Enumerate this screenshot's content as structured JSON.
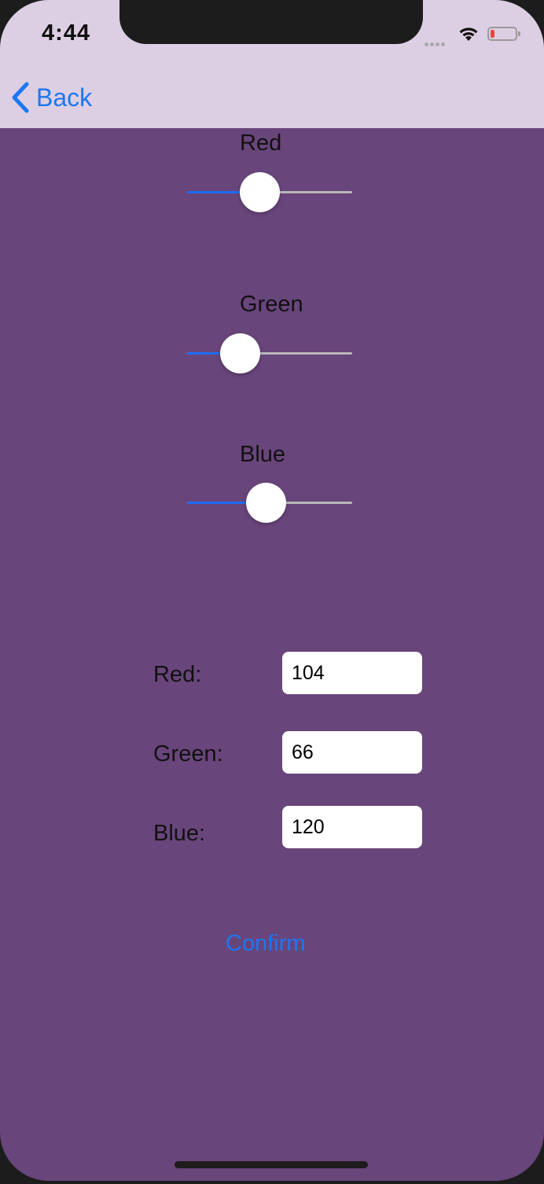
{
  "status_bar": {
    "time": "4:44"
  },
  "nav": {
    "back_label": "Back"
  },
  "sliders": [
    {
      "label": "Red",
      "value": 0.44
    },
    {
      "label": "Green",
      "value": 0.32
    },
    {
      "label": "Blue",
      "value": 0.48
    }
  ],
  "fields": [
    {
      "label": "Red:",
      "value": "104"
    },
    {
      "label": "Green:",
      "value": "66"
    },
    {
      "label": "Blue:",
      "value": "120"
    }
  ],
  "confirm_label": "Confirm",
  "colors": {
    "background": "#68457a",
    "nav_bar": "#ddcfe3",
    "accent": "#1d77f2"
  }
}
